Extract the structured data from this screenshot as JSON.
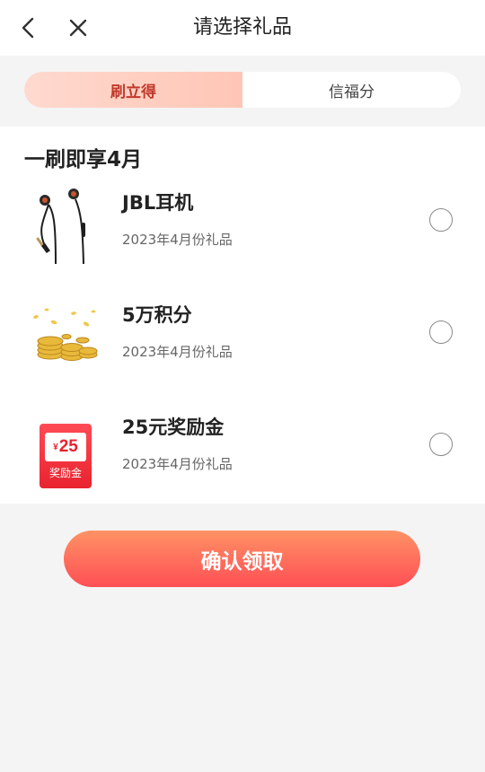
{
  "header": {
    "title": "请选择礼品",
    "back_icon": "chevron-left-icon",
    "close_icon": "close-icon"
  },
  "tabs": [
    {
      "label": "刷立得",
      "active": true
    },
    {
      "label": "信福分",
      "active": false
    }
  ],
  "section": {
    "title": "一刷即享4月"
  },
  "gifts": [
    {
      "name": "JBL耳机",
      "subtitle": "2023年4月份礼品",
      "selected": false,
      "icon": "earphones-image"
    },
    {
      "name": "5万积分",
      "subtitle": "2023年4月份礼品",
      "selected": false,
      "icon": "gold-coins-image"
    },
    {
      "name": "25元奖励金",
      "subtitle": "2023年4月份礼品",
      "selected": false,
      "icon": "voucher-image",
      "voucher": {
        "currency": "¥",
        "amount": "25",
        "label": "奖励金"
      }
    }
  ],
  "confirm_button": {
    "label": "确认领取"
  },
  "colors": {
    "accent": "#ff4f55",
    "accent_light": "#ff9265",
    "tab_active_bg": "#ffd0c3",
    "tab_active_text": "#c0392b",
    "page_bg": "#f4f4f4"
  }
}
